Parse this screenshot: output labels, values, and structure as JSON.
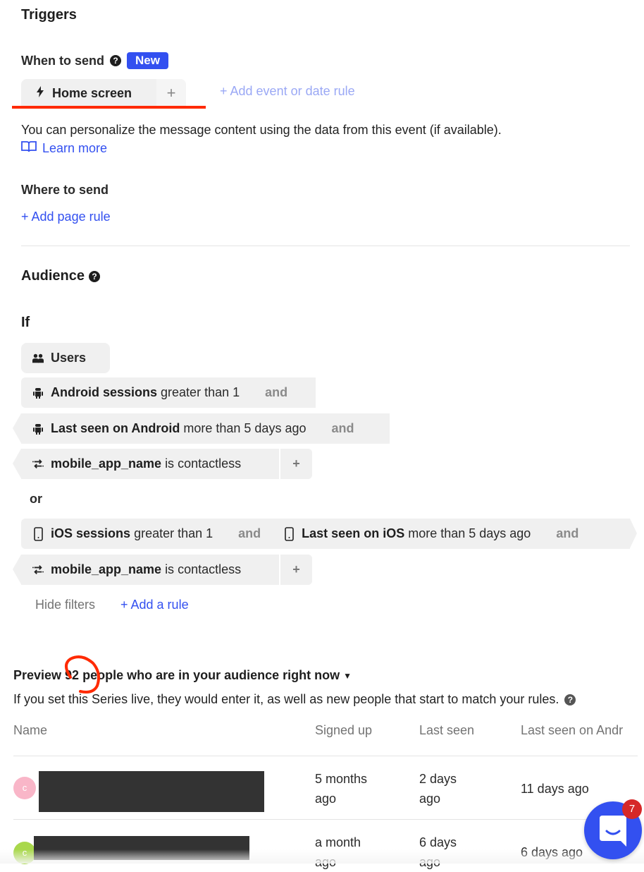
{
  "triggers": {
    "title": "Triggers",
    "when_to_send": {
      "label": "When to send",
      "badge": "New",
      "event_chip": {
        "icon": "lightning-icon",
        "label": "Home screen",
        "add": "+"
      },
      "add_rule": "+ Add event or date rule",
      "help_text": "You can personalize the message content using the data from this event (if available).",
      "learn_more": "Learn more"
    },
    "where_to_send": {
      "label": "Where to send",
      "add_rule": "+ Add page rule"
    }
  },
  "audience": {
    "title": "Audience",
    "if_label": "If",
    "type_chip": {
      "icon": "users-icon",
      "label": "Users"
    },
    "group1": [
      {
        "icon": "android-icon",
        "field": "Android sessions",
        "condition": "greater than 1",
        "connector": "and"
      },
      {
        "icon": "android-icon",
        "field": "Last seen on Android",
        "condition": "more than 5 days ago",
        "connector": "and"
      },
      {
        "icon": "attribute-icon",
        "field": "mobile_app_name",
        "condition": "is contactless",
        "connector": "+"
      }
    ],
    "or_label": "or",
    "group2": [
      {
        "icon": "phone-icon",
        "field": "iOS sessions",
        "condition": "greater than 1",
        "connector": "and"
      },
      {
        "icon": "phone-icon",
        "field": "Last seen on iOS",
        "condition": "more than 5 days ago",
        "connector": "and"
      },
      {
        "icon": "attribute-icon",
        "field": "mobile_app_name",
        "condition": "is contactless",
        "connector": "+"
      }
    ],
    "hide_filters": "Hide filters",
    "add_rule": "+ Add a rule"
  },
  "preview": {
    "title_prefix": "Preview",
    "count": "92",
    "title_suffix": "people who are in your audience right now",
    "subtitle": "If you set this Series live, they would enter it, as well as new people that start to match your rules.",
    "columns": [
      "Name",
      "Signed up",
      "Last seen",
      "Last seen on Andr"
    ],
    "rows": [
      {
        "avatar_letter": "c",
        "avatar_color": "#f9b6c8",
        "signed_up": [
          "5 months",
          "ago"
        ],
        "last_seen": [
          "2 days",
          "ago"
        ],
        "last_seen_android": "11 days ago"
      },
      {
        "avatar_letter": "c",
        "avatar_color": "#a9d84c",
        "signed_up": [
          "a month",
          "ago"
        ],
        "last_seen": [
          "6 days",
          "ago"
        ],
        "last_seen_android": "6 days ago"
      }
    ]
  },
  "messenger": {
    "unread_count": "7",
    "color": "#3350f0",
    "badge_color": "#d62828"
  },
  "annotation_color": "#ff2a00"
}
